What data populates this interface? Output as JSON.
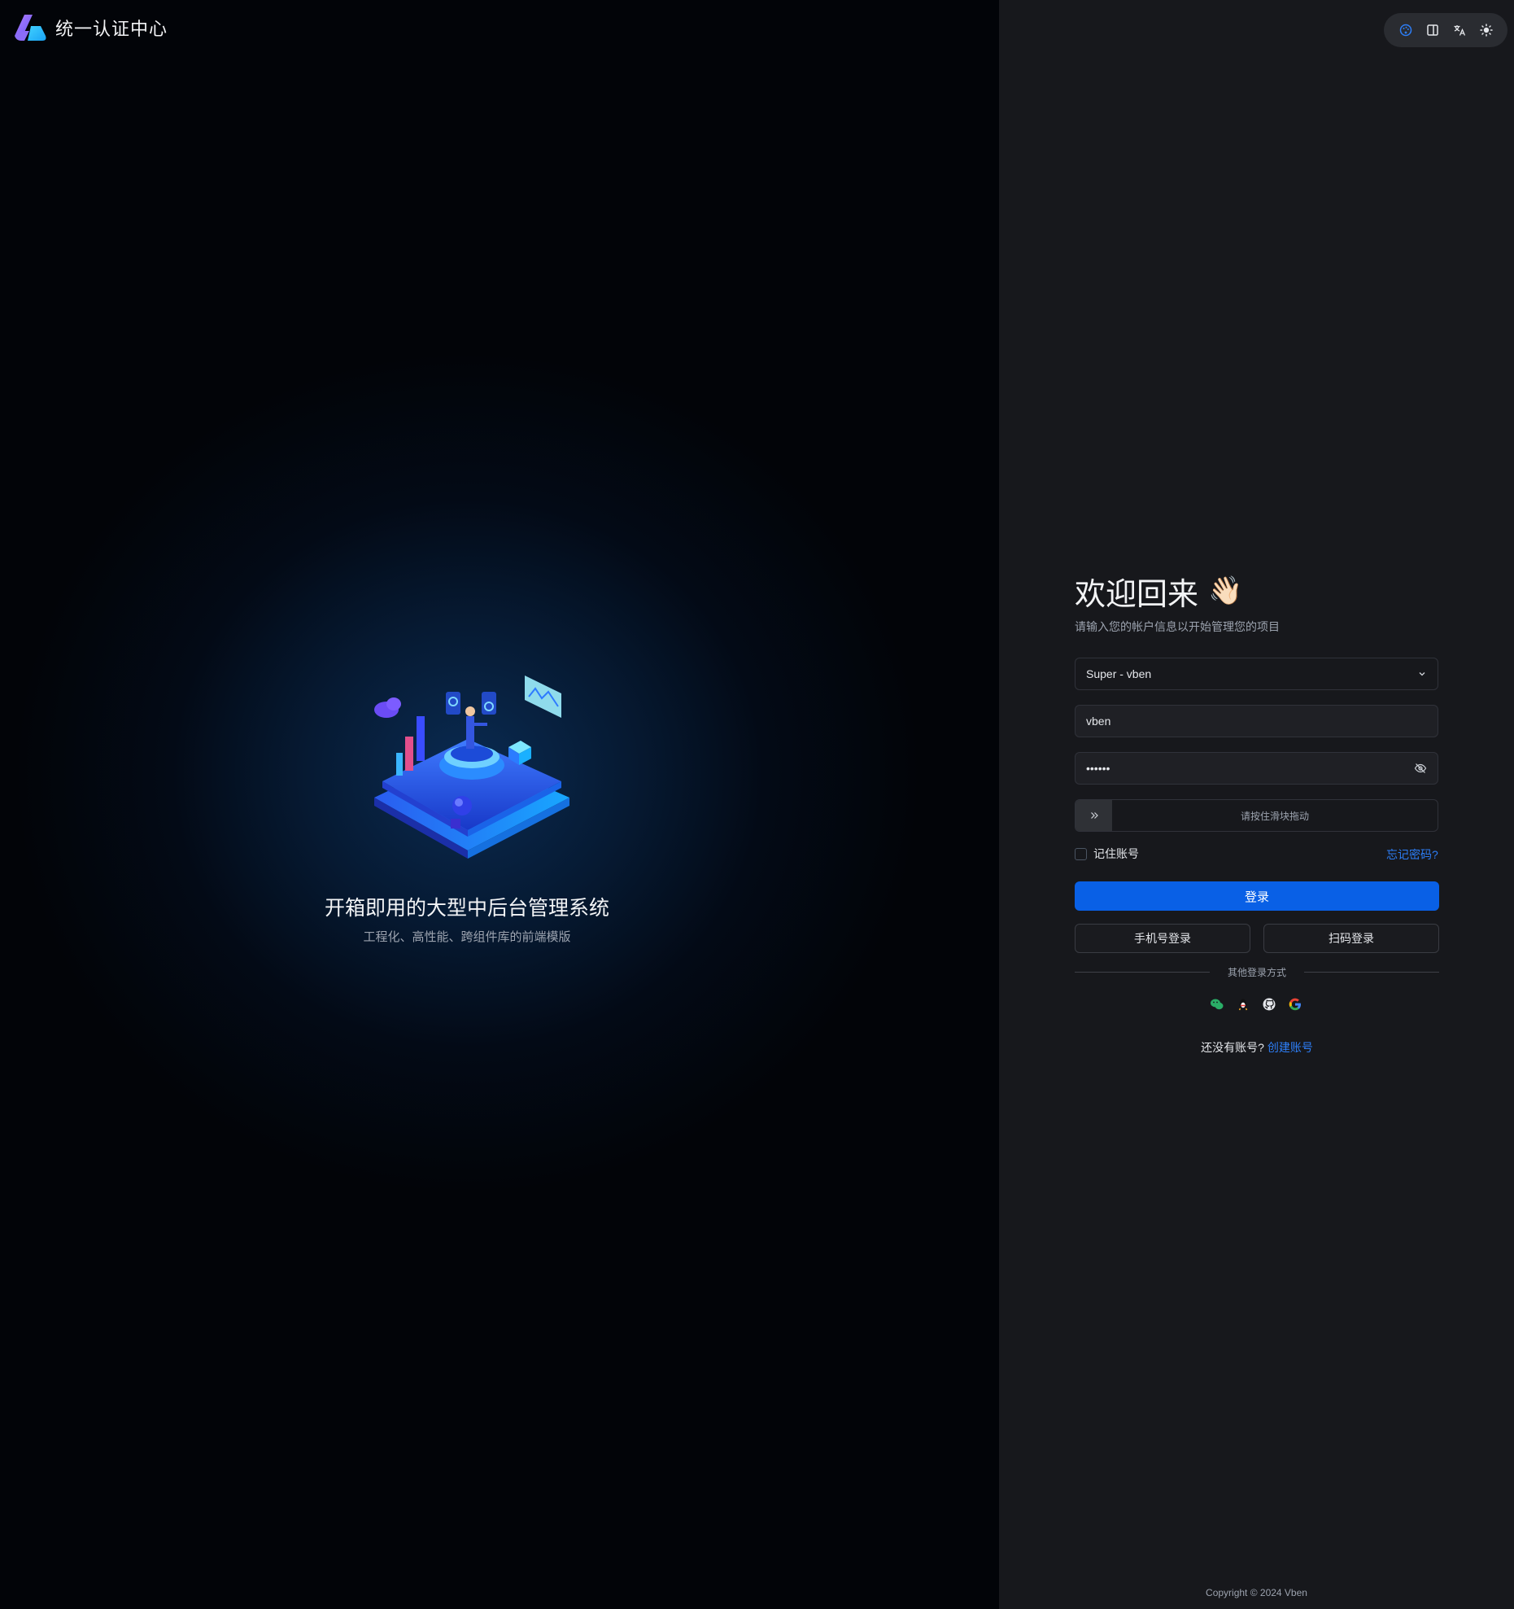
{
  "brand": {
    "name": "统一认证中心",
    "logo_icon": "vben-logo-icon"
  },
  "hero": {
    "illustration": "isometric-dashboard-illustration",
    "title": "开箱即用的大型中后台管理系统",
    "subtitle": "工程化、高性能、跨组件库的前端模版"
  },
  "toolbar": {
    "items": [
      "palette-icon",
      "layout-panel-icon",
      "translate-icon",
      "sun-icon"
    ]
  },
  "login": {
    "welcome": "欢迎回来",
    "wave_emoji": "👋🏻",
    "subtitle": "请输入您的帐户信息以开始管理您的项目",
    "account_select": {
      "value": "Super - vben"
    },
    "username": {
      "value": "vben"
    },
    "password": {
      "value": "••••••"
    },
    "slider": {
      "text": "请按住滑块拖动"
    },
    "remember_label": "记住账号",
    "forgot_label": "忘记密码?",
    "login_button": "登录",
    "phone_login": "手机号登录",
    "qr_login": "扫码登录",
    "other_methods": "其他登录方式",
    "socials": [
      "wechat-icon",
      "qq-icon",
      "github-icon",
      "google-icon"
    ],
    "no_account": "还没有账号?",
    "create_account": "创建账号"
  },
  "footer": {
    "copyright": "Copyright © 2024 Vben"
  },
  "colors": {
    "accent": "#0960e6",
    "link": "#2d7ef7",
    "panel": "#17181c"
  }
}
